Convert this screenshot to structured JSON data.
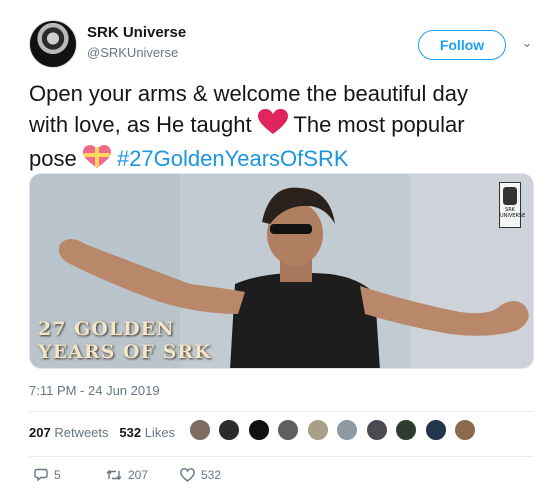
{
  "user": {
    "name": "SRK Universe",
    "handle": "@SRKUniverse",
    "follow_label": "Follow"
  },
  "tweet": {
    "line1": "Open your arms & welcome the beautiful day",
    "line2_a": "with love, as He taught ",
    "line2_b": " The most popular",
    "line3_a": "pose ",
    "hashtag": "#27GoldenYearsOfSRK"
  },
  "media": {
    "caption_line1": "27 GOLDEN",
    "caption_line2": "YEARS OF SRK",
    "logo_text": "SRK UNIVERSE"
  },
  "timestamp": "7:11 PM - 24 Jun 2019",
  "stats": {
    "retweets_count": "207",
    "retweets_label": "Retweets",
    "likes_count": "532",
    "likes_label": "Likes"
  },
  "actions": {
    "replies": "5",
    "retweets": "207",
    "likes": "532"
  },
  "colors": {
    "accent": "#1da1f2",
    "hashtag": "#1b95e0",
    "muted": "#657786",
    "heart": "#e0245e"
  },
  "icons": [
    "caret-down-icon",
    "reply-icon",
    "retweet-icon",
    "like-icon",
    "red-heart-emoji",
    "gift-heart-emoji"
  ]
}
